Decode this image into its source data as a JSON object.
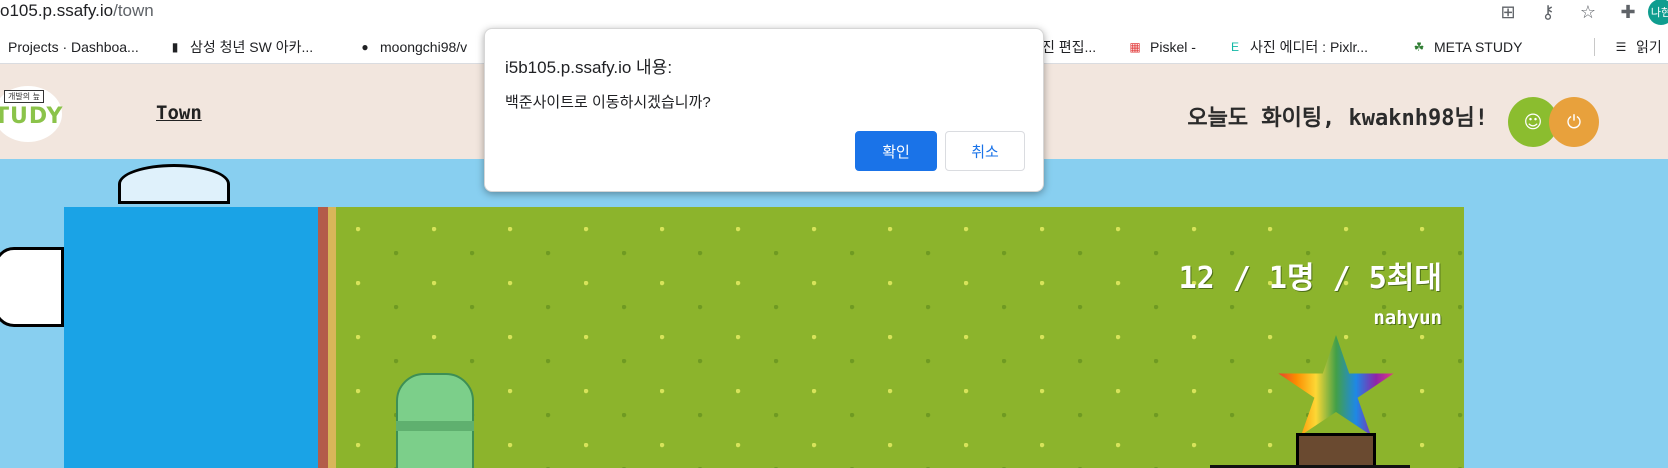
{
  "browser": {
    "url_prefix": "o105.p.ssafy.io",
    "url_path": "/town",
    "profile_label": "나현"
  },
  "bookmarks": [
    {
      "label": "Projects · Dashboa...",
      "icon": "page-icon"
    },
    {
      "label": "삼성 청년 SW 아카...",
      "icon": "samsung-icon"
    },
    {
      "label": "moongchi98/v",
      "icon": "github-icon"
    },
    {
      "label": "진 편집...",
      "icon": "page-icon"
    },
    {
      "label": "Piskel -",
      "icon": "piskel-icon"
    },
    {
      "label": "사진 에디터 : Pixlr...",
      "icon": "pixlr-icon"
    },
    {
      "label": "META STUDY",
      "icon": "turtle-icon"
    },
    {
      "label": "읽기",
      "icon": "reading-list-icon"
    }
  ],
  "navbar": {
    "logo_top": "개발의 늪",
    "logo_main": "TUDY",
    "town_link": "Town",
    "greeting": "오늘도 화이팅, kwaknh98님!"
  },
  "game": {
    "room_info": "12 / 1명 / 5최대",
    "nickname": "nahyun"
  },
  "dialog": {
    "title": "i5b105.p.ssafy.io 내용:",
    "message": "백준사이트로 이동하시겠습니까?",
    "ok_label": "확인",
    "cancel_label": "취소"
  },
  "colors": {
    "accent": "#1a73e8",
    "navbar_bg": "#f2e6de",
    "grass": "#8cb42c",
    "sky": "#88cff0",
    "user_button": "#8bbd2f",
    "power_button": "#e8a13c"
  }
}
